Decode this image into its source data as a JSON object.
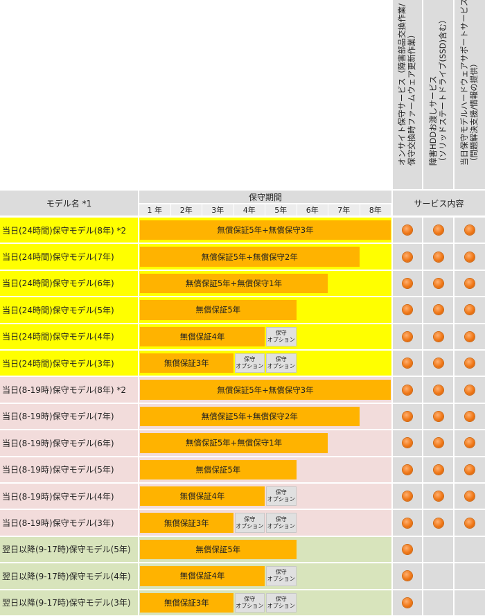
{
  "header": {
    "model_name": "モデル名 *1",
    "period": "保守期間",
    "service": "サービス内容",
    "years": [
      "1 年",
      "2年",
      "3年",
      "4年",
      "5年",
      "6年",
      "7年",
      "8年"
    ],
    "service_columns": [
      {
        "line1": "オンサイト保守サービス（障害部品交換作業/",
        "line2": "保守交換時ファームウェア更新作業）"
      },
      {
        "line1": "障害HDDお渡しサービス",
        "line2": "（ソリッドステートドライブ(SSD)含む）"
      },
      {
        "line1": "当日保守モデルハードウェアサポートサービス",
        "line2": "（問題解決支援/情報の提供）"
      }
    ]
  },
  "option_label": {
    "line1": "保守",
    "line2": "オプション"
  },
  "colors": {
    "yellow": "#ffff00",
    "pink": "#f2dcdb",
    "green": "#d8e4bc",
    "bar": "#ffb300",
    "gray": "#dcdcdc",
    "dot": "#f07818"
  },
  "rows": [
    {
      "label": "当日(24時間)保守モデル(8年) *2",
      "bg": "yellow",
      "bar_text": "無償保証5年+無償保守3年",
      "bar_years": 8,
      "options": 0,
      "services": [
        true,
        true,
        true
      ]
    },
    {
      "label": "当日(24時間)保守モデル(7年)",
      "bg": "yellow",
      "bar_text": "無償保証5年+無償保守2年",
      "bar_years": 7,
      "options": 0,
      "services": [
        true,
        true,
        true
      ]
    },
    {
      "label": "当日(24時間)保守モデル(6年)",
      "bg": "yellow",
      "bar_text": "無償保証5年+無償保守1年",
      "bar_years": 6,
      "options": 0,
      "services": [
        true,
        true,
        true
      ]
    },
    {
      "label": "当日(24時間)保守モデル(5年)",
      "bg": "yellow",
      "bar_text": "無償保証5年",
      "bar_years": 5,
      "options": 0,
      "services": [
        true,
        true,
        true
      ]
    },
    {
      "label": "当日(24時間)保守モデル(4年)",
      "bg": "yellow",
      "bar_text": "無償保証4年",
      "bar_years": 4,
      "options": 1,
      "services": [
        true,
        true,
        true
      ]
    },
    {
      "label": "当日(24時間)保守モデル(3年)",
      "bg": "yellow",
      "bar_text": "無償保証3年",
      "bar_years": 3,
      "options": 2,
      "services": [
        true,
        true,
        true
      ]
    },
    {
      "label": "当日(8-19時)保守モデル(8年) *2",
      "bg": "pink",
      "bar_text": "無償保証5年+無償保守3年",
      "bar_years": 8,
      "options": 0,
      "services": [
        true,
        true,
        true
      ]
    },
    {
      "label": "当日(8-19時)保守モデル(7年)",
      "bg": "pink",
      "bar_text": "無償保証5年+無償保守2年",
      "bar_years": 7,
      "options": 0,
      "services": [
        true,
        true,
        true
      ]
    },
    {
      "label": "当日(8-19時)保守モデル(6年)",
      "bg": "pink",
      "bar_text": "無償保証5年+無償保守1年",
      "bar_years": 6,
      "options": 0,
      "services": [
        true,
        true,
        true
      ]
    },
    {
      "label": "当日(8-19時)保守モデル(5年)",
      "bg": "pink",
      "bar_text": "無償保証5年",
      "bar_years": 5,
      "options": 0,
      "services": [
        true,
        true,
        true
      ]
    },
    {
      "label": "当日(8-19時)保守モデル(4年)",
      "bg": "pink",
      "bar_text": "無償保証4年",
      "bar_years": 4,
      "options": 1,
      "services": [
        true,
        true,
        true
      ]
    },
    {
      "label": "当日(8-19時)保守モデル(3年)",
      "bg": "pink",
      "bar_text": "無償保証3年",
      "bar_years": 3,
      "options": 2,
      "services": [
        true,
        true,
        true
      ]
    },
    {
      "label": "翌日以降(9-17時)保守モデル(5年)",
      "bg": "green",
      "bar_text": "無償保証5年",
      "bar_years": 5,
      "options": 0,
      "services": [
        true,
        false,
        false
      ]
    },
    {
      "label": "翌日以降(9-17時)保守モデル(4年)",
      "bg": "green",
      "bar_text": "無償保証4年",
      "bar_years": 4,
      "options": 1,
      "services": [
        true,
        false,
        false
      ]
    },
    {
      "label": "翌日以降(9-17時)保守モデル(3年)",
      "bg": "green",
      "bar_text": "無償保証3年",
      "bar_years": 3,
      "options": 2,
      "services": [
        true,
        false,
        false
      ]
    }
  ]
}
